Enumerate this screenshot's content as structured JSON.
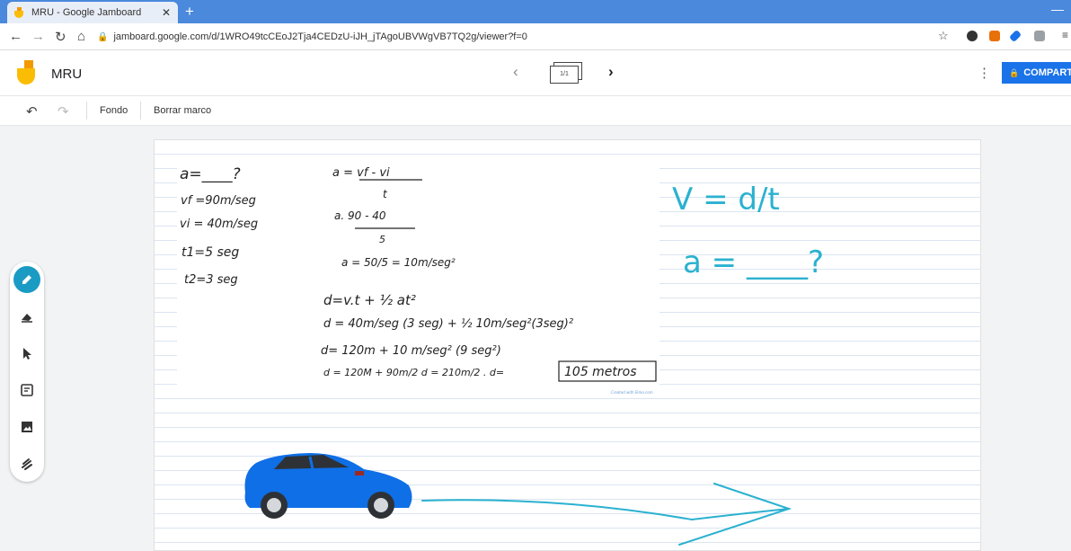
{
  "browser": {
    "tab_title": "MRU - Google Jamboard",
    "url": "jamboard.google.com/d/1WRO49tcCEoJ2Tja4CEDzU-iJH_jTAgoUBVWgVB7TQ2g/viewer?f=0"
  },
  "app": {
    "title": "MRU",
    "frame_indicator": "1/1",
    "share_label": "COMPARTIR"
  },
  "toolbar": {
    "background_label": "Fondo",
    "clear_frame_label": "Borrar marco"
  },
  "board": {
    "left_column": [
      "a=____?",
      "vf =90m/seg",
      "vi = 40m/seg",
      "t1=5 seg",
      "t2=3 seg"
    ],
    "mid_formula_1": "a = vf - vi",
    "mid_formula_1_den": "t",
    "mid_formula_2": "a. 90 - 40",
    "mid_formula_2_den": "5",
    "mid_formula_3": "a = 50/5 = 10m/seg²",
    "mid_formula_4": "d=v.t + ½ at²",
    "mid_formula_5": "d = 40m/seg (3 seg) + ½ 10m/seg²(3seg)²",
    "mid_formula_6": "d= 120m + 10 m/seg² (9 seg²)",
    "mid_formula_7": "d = 120M + 90m/2 d = 210m/2 . d=",
    "answer": "105 metros",
    "created_with": "Created with Elmo.com",
    "right_formula_1": "V = d/t",
    "right_formula_2": "a = ____?"
  },
  "colors": {
    "ink_teal": "#2bb1d0",
    "car_blue": "#0f6fe6",
    "pen_active": "#1a9bc4",
    "share_blue": "#1a73e8"
  },
  "tools": [
    "pen-icon",
    "eraser-icon",
    "select-icon",
    "sticky-note-icon",
    "image-icon",
    "laser-icon"
  ]
}
